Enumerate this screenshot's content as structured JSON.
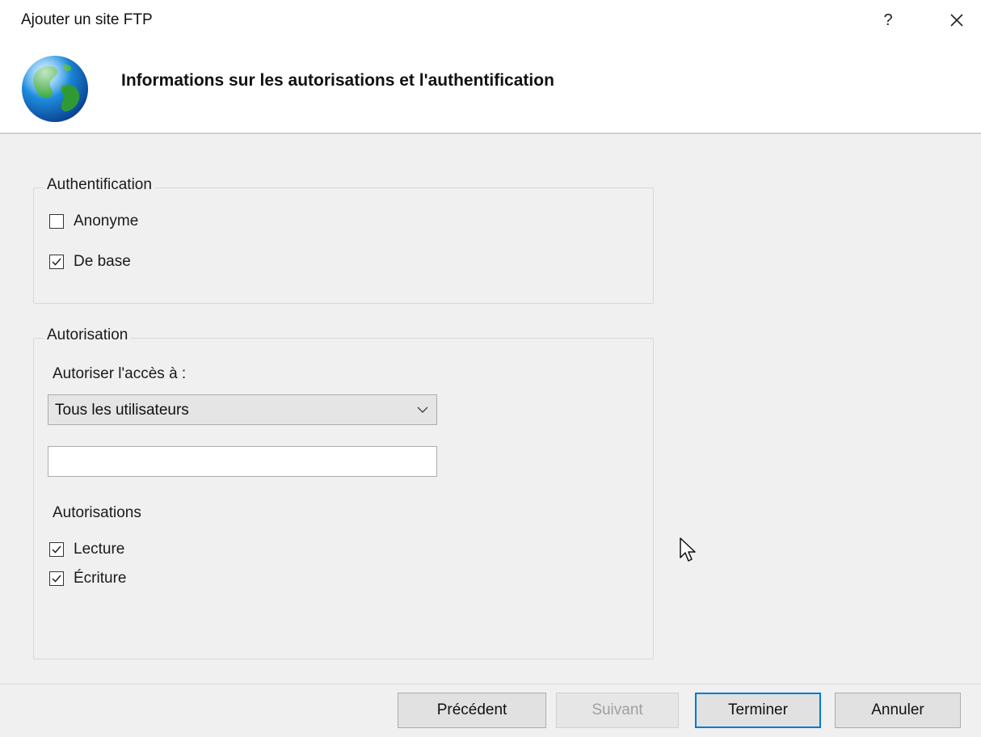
{
  "window": {
    "title": "Ajouter un site FTP",
    "help_label": "?",
    "close_icon": "close-icon"
  },
  "header": {
    "icon": "globe-icon",
    "title": "Informations sur les autorisations et l'authentification"
  },
  "authentication": {
    "legend": "Authentification",
    "options": [
      {
        "label": "Anonyme",
        "checked": false
      },
      {
        "label": "De base",
        "checked": true
      }
    ]
  },
  "authorization": {
    "legend": "Autorisation",
    "access_label": "Autoriser l'accès à :",
    "access_select": {
      "value": "Tous les utilisateurs"
    },
    "user_input": {
      "value": "",
      "placeholder": ""
    },
    "permissions_label": "Autorisations",
    "permissions": [
      {
        "label": "Lecture",
        "checked": true
      },
      {
        "label": "Écriture",
        "checked": true
      }
    ]
  },
  "footer": {
    "previous_label": "Précédent",
    "next_label": "Suivant",
    "finish_label": "Terminer",
    "cancel_label": "Annuler"
  },
  "colors": {
    "accent": "#0078d7",
    "body_bg": "#f0f0f0",
    "button_bg": "#e1e1e1"
  }
}
